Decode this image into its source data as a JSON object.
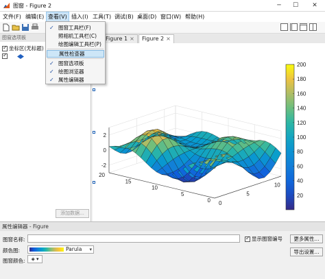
{
  "window": {
    "title": "图窗 - Figure 2",
    "minimize": "─",
    "maximize": "☐",
    "close": "✕"
  },
  "menu": [
    "文件(F)",
    "编辑(E)",
    "查看(V)",
    "插入(I)",
    "工具(T)",
    "调试(B)",
    "桌面(D)",
    "窗口(W)",
    "帮助(H)"
  ],
  "view_menu": {
    "items": [
      {
        "label": "图窗工具栏(F)",
        "checked": true
      },
      {
        "label": "照相机工具栏(C)",
        "checked": false
      },
      {
        "label": "绘图编辑工具栏(P)",
        "checked": false
      },
      {
        "label": "属性检查器",
        "checked": false,
        "hover": true
      },
      {
        "label": "图窗选项板",
        "checked": true
      },
      {
        "label": "绘图浏览器",
        "checked": true
      },
      {
        "label": "属性编辑器",
        "checked": true
      }
    ]
  },
  "left_panel": {
    "header": "图窗选项板",
    "tree": [
      "坐标区(无标题)"
    ],
    "add_data": "添加数据..."
  },
  "tabs": [
    {
      "label": "Figure 1",
      "active": false
    },
    {
      "label": "Figure 2",
      "active": true
    }
  ],
  "chart_data": {
    "type": "surface",
    "title": "",
    "x_ticks": [
      "0",
      "5",
      "10"
    ],
    "y_ticks": [
      "0",
      "5",
      "10",
      "15",
      "20"
    ],
    "z_ticks": [
      "-2",
      "0",
      "2"
    ],
    "colorbar_ticks": [
      "20",
      "40",
      "60",
      "80",
      "100",
      "120",
      "140",
      "160",
      "180",
      "200"
    ],
    "colorbar_range": [
      0,
      200
    ],
    "colormap": "parula"
  },
  "prop_editor": {
    "header": "属性编辑器 - Figure",
    "name_label": "图窗名称:",
    "name_value": "",
    "show_number": "显示图窗编号",
    "show_number_checked": true,
    "more_props": "更多属性...",
    "colormap_label": "颜色图:",
    "colormap_value": "Parula",
    "figcolor_label": "图窗颜色:",
    "export": "导出设置..."
  }
}
